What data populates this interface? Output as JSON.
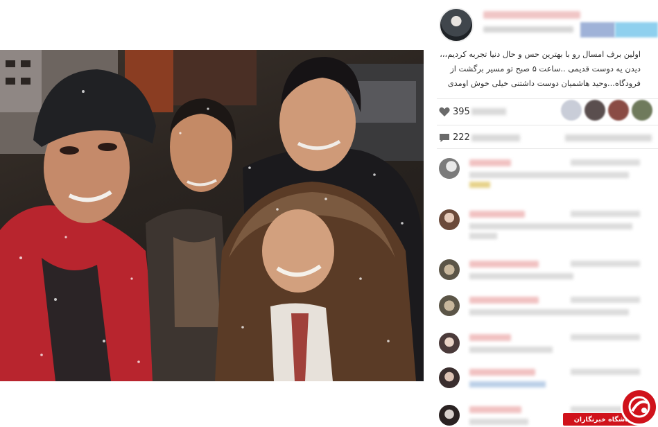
{
  "post": {
    "caption": "اولین برف امسال رو با بهترین حس و حال دنیا تجربه کردیم،،، دیدن یه دوست قدیمی ..ساعت ۵ صبح تو مسیر برگشت از فرودگاه...وحید هاشمیان دوست داشتنی خیلی خوش اومدی",
    "likes_count": "395",
    "comments_count": "222"
  },
  "icons": {
    "like": "heart-icon",
    "comments": "comment-icon",
    "watermark_logo": "club-logo-icon"
  },
  "colors": {
    "accent_red": "#d0121b",
    "username_pink": "#f1c2c2",
    "facebook_blue": "#9fb2d8",
    "twitter_blue": "#8fd0ee"
  },
  "watermark": {
    "label": "باشگاه خبرنگاران"
  }
}
